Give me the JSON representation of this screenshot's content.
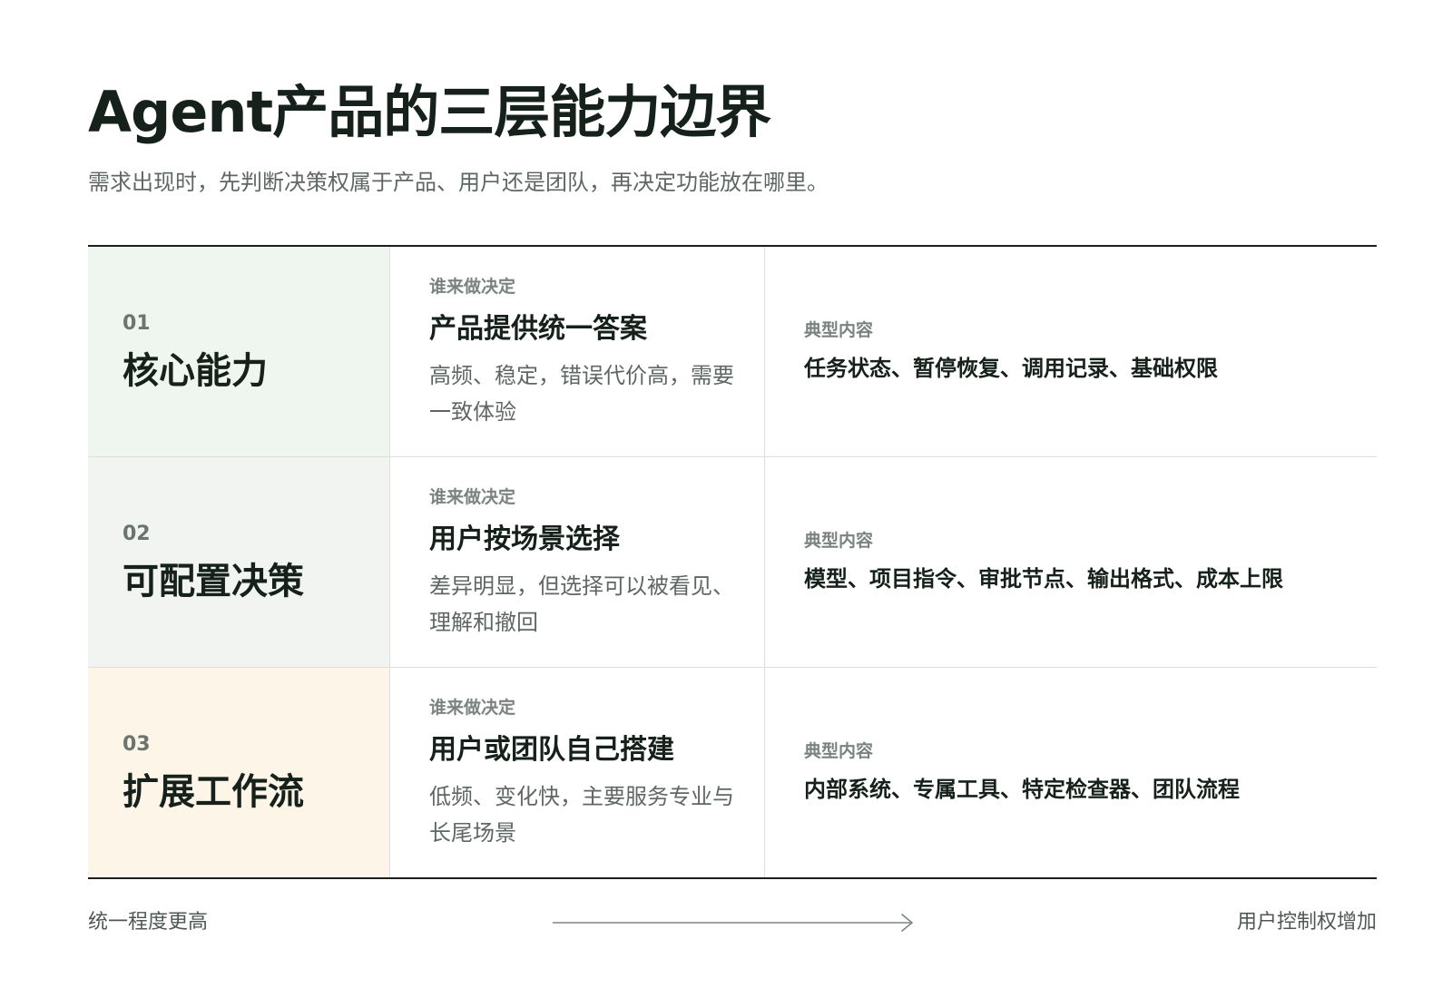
{
  "title": "Agent产品的三层能力边界",
  "subtitle": "需求出现时，先判断决策权属于产品、用户还是团队，再决定功能放在哪里。",
  "decider_label": "谁来做决定",
  "content_label": "典型内容",
  "layers": [
    {
      "num": "01",
      "name": "核心能力",
      "decider": "产品提供统一答案",
      "desc": "高频、稳定，错误代价高，需要一致体验",
      "content": "任务状态、暂停恢复、调用记录、基础权限",
      "bg": "#eef6ef"
    },
    {
      "num": "02",
      "name": "可配置决策",
      "decider": "用户按场景选择",
      "desc": "差异明显，但选择可以被看见、理解和撤回",
      "content": "模型、项目指令、审批节点、输出格式、成本上限",
      "bg": "#f2f4f2"
    },
    {
      "num": "03",
      "name": "扩展工作流",
      "decider": "用户或团队自己搭建",
      "desc": "低频、变化快，主要服务专业与长尾场景",
      "content": "内部系统、专属工具、特定检查器、团队流程",
      "bg": "#fdf5e8"
    }
  ],
  "footer": {
    "left": "统一程度更高",
    "right": "用户控制权增加",
    "arrow_color": "#7d8681"
  }
}
